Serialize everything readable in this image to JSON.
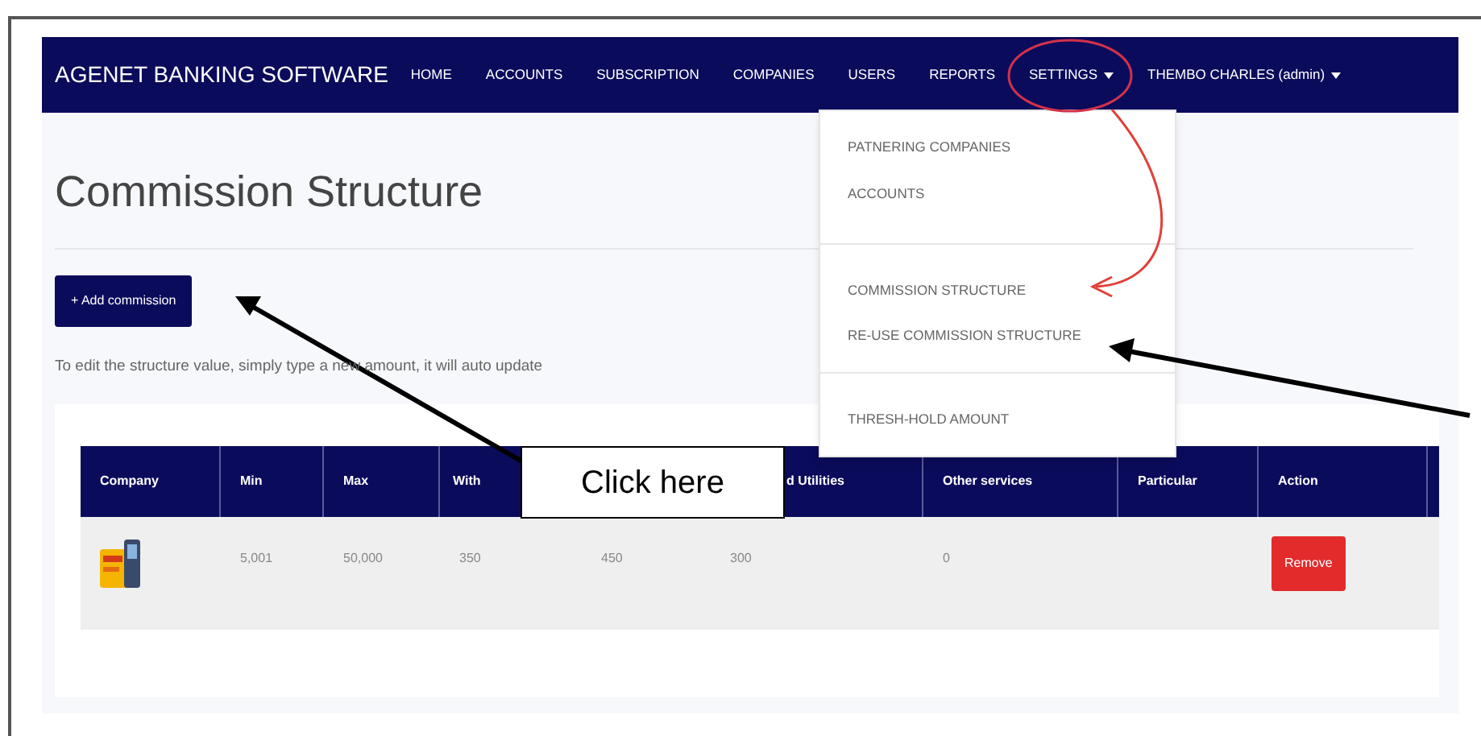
{
  "navbar": {
    "brand": "AGENET BANKING SOFTWARE",
    "links": [
      {
        "label": "HOME",
        "dropdown": false
      },
      {
        "label": "ACCOUNTS",
        "dropdown": false
      },
      {
        "label": "SUBSCRIPTION",
        "dropdown": false
      },
      {
        "label": "COMPANIES",
        "dropdown": false
      },
      {
        "label": "USERS",
        "dropdown": false
      },
      {
        "label": "REPORTS",
        "dropdown": false
      },
      {
        "label": "SETTINGS",
        "dropdown": true
      }
    ],
    "user": {
      "label": "THEMBO CHARLES (admin)",
      "dropdown": true
    }
  },
  "settings_menu": {
    "groups": [
      [
        "PATNERING COMPANIES",
        "ACCOUNTS"
      ],
      [
        "COMMISSION STRUCTURE",
        "RE-USE COMMISSION STRUCTURE"
      ],
      [
        "THRESH-HOLD AMOUNT"
      ]
    ]
  },
  "page": {
    "title": "Commission Structure",
    "add_button": "+ Add commission",
    "hint": "To edit the structure value, simply type a new amount, it will auto update"
  },
  "table": {
    "columns": [
      {
        "label": "Company"
      },
      {
        "label": "Min"
      },
      {
        "label": "Max"
      },
      {
        "label": "With"
      },
      {},
      {
        "label": "d Utilities"
      },
      {
        "label": "Other services"
      },
      {
        "label": "Particular"
      },
      {
        "label": "Action"
      }
    ],
    "rows": [
      {
        "cells": [
          {
            "kind": "picture"
          },
          {
            "kind": "text",
            "text": "5,001"
          },
          {
            "kind": "text",
            "text": "50,000"
          },
          {
            "kind": "text",
            "text": "350"
          },
          {
            "kind": "text",
            "text": "450"
          },
          {
            "kind": "text",
            "text": "300"
          },
          {
            "kind": "text",
            "text": "0"
          },
          {
            "kind": "empty"
          },
          {
            "kind": "button",
            "text": "Remove"
          }
        ]
      }
    ]
  },
  "annotation": {
    "callout": "Click here"
  }
}
